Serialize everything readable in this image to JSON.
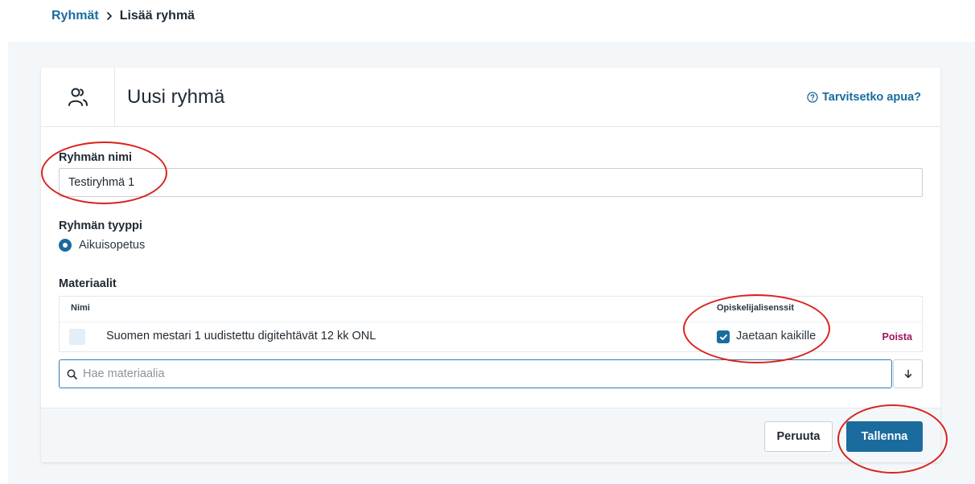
{
  "breadcrumb": {
    "parent": "Ryhmät",
    "current": "Lisää ryhmä"
  },
  "header": {
    "title": "Uusi ryhmä",
    "help_label": "Tarvitsetko apua?"
  },
  "form": {
    "name_label": "Ryhmän nimi",
    "name_value": "Testiryhmä 1",
    "type_label": "Ryhmän tyyppi",
    "type_selected": "Aikuisopetus",
    "materials_label": "Materiaalit"
  },
  "materials_table": {
    "col_name": "Nimi",
    "col_licenses": "Opiskelijalisenssit",
    "rows": [
      {
        "name": "Suomen mestari 1 uudistettu digitehtävät 12 kk ONL",
        "license_checkbox_label": "Jaetaan kaikille",
        "license_checked": true,
        "remove_label": "Poista"
      }
    ]
  },
  "search": {
    "placeholder": "Hae materiaalia",
    "value": ""
  },
  "footer": {
    "cancel_label": "Peruuta",
    "save_label": "Tallenna"
  },
  "colors": {
    "accent": "#1a6b9e",
    "danger_link": "#a3155a",
    "annotation": "#d9231d",
    "page_bg": "#f4f7f9"
  },
  "icons": {
    "header": "users-icon",
    "help": "question-circle-icon",
    "search": "search-icon",
    "dropdown": "arrow-down-icon",
    "breadcrumb_sep": "chevron-right-icon"
  }
}
